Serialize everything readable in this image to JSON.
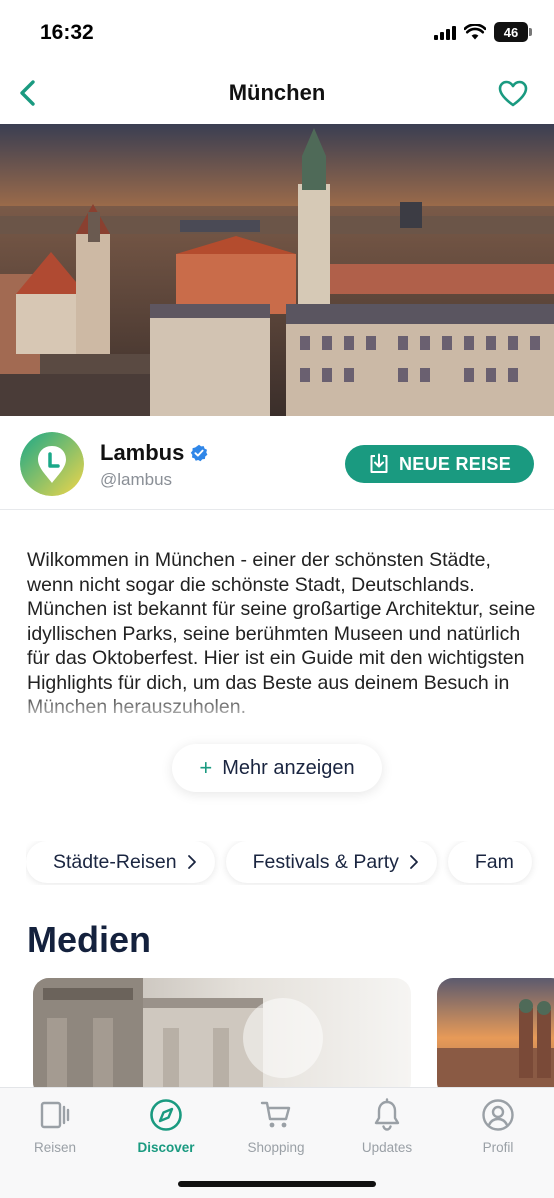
{
  "status_bar": {
    "time": "16:32",
    "battery": "46",
    "icons": [
      "signal-icon",
      "wifi-icon",
      "battery-icon"
    ]
  },
  "nav": {
    "title": "München",
    "back_icon": "chevron-left-icon",
    "favorite_icon": "heart-icon"
  },
  "hero": {
    "subject": "munich-skyline-photo"
  },
  "author": {
    "name": "Lambus",
    "handle": "@lambus",
    "verified": true,
    "new_trip_label": "NEUE REISE"
  },
  "description": {
    "text": "Wilkommen in München - einer der schönsten Städte, wenn nicht sogar die schönste Stadt, Deutschlands. München ist bekannt für seine großartige Architektur, seine idyllischen Parks, seine berühmten Museen und natürlich für das Oktoberfest. Hier ist ein Guide mit den wichtigsten Highlights für dich, um das Beste aus deinem Besuch in München herauszuholen.",
    "more_label": "Mehr anzeigen"
  },
  "chips": [
    {
      "label": "Städte-Reisen"
    },
    {
      "label": "Festivals & Party"
    },
    {
      "label": "Fam"
    }
  ],
  "media": {
    "title": "Medien"
  },
  "tabs": [
    {
      "label": "Reisen",
      "icon": "trips-icon",
      "active": false
    },
    {
      "label": "Discover",
      "icon": "compass-icon",
      "active": true
    },
    {
      "label": "Shopping",
      "icon": "cart-icon",
      "active": false
    },
    {
      "label": "Updates",
      "icon": "bell-icon",
      "active": false
    },
    {
      "label": "Profil",
      "icon": "profile-icon",
      "active": false
    }
  ],
  "colors": {
    "accent": "#1a9a80",
    "heading": "#14213d",
    "verified": "#2f86e8"
  }
}
